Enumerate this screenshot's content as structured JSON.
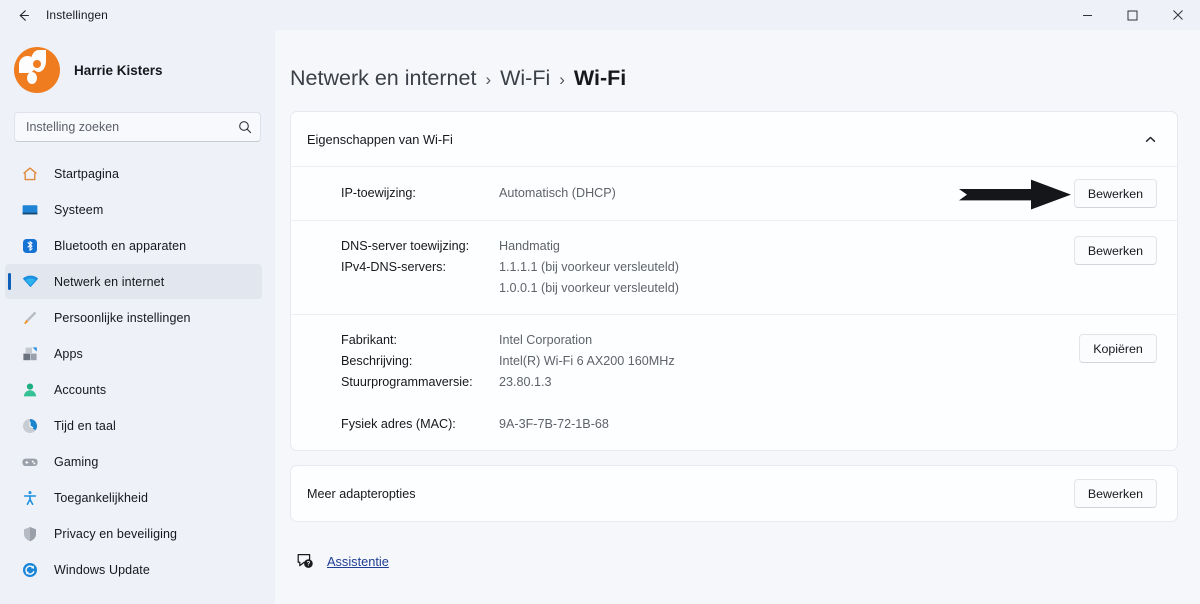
{
  "window": {
    "title": "Instellingen",
    "back_icon": "back-arrow-icon",
    "minimize_label": "−",
    "maximize_label": "□",
    "close_label": "✕"
  },
  "sidebar": {
    "profile": {
      "name": "Harrie Kisters",
      "avatar": "user-avatar"
    },
    "search": {
      "placeholder": "Instelling zoeken",
      "value": "",
      "icon": "search-icon"
    },
    "items": [
      {
        "label": "Startpagina",
        "icon": "home-icon",
        "selected": false
      },
      {
        "label": "Systeem",
        "icon": "monitor-icon",
        "selected": false
      },
      {
        "label": "Bluetooth en apparaten",
        "icon": "bluetooth-icon",
        "selected": false
      },
      {
        "label": "Netwerk en internet",
        "icon": "wifi-icon",
        "selected": true
      },
      {
        "label": "Persoonlijke instellingen",
        "icon": "paintbrush-icon",
        "selected": false
      },
      {
        "label": "Apps",
        "icon": "apps-icon",
        "selected": false
      },
      {
        "label": "Accounts",
        "icon": "account-icon",
        "selected": false
      },
      {
        "label": "Tijd en taal",
        "icon": "clock-icon",
        "selected": false
      },
      {
        "label": "Gaming",
        "icon": "gamepad-icon",
        "selected": false
      },
      {
        "label": "Toegankelijkheid",
        "icon": "accessibility-icon",
        "selected": false
      },
      {
        "label": "Privacy en beveiliging",
        "icon": "shield-icon",
        "selected": false
      },
      {
        "label": "Windows Update",
        "icon": "update-icon",
        "selected": false
      }
    ]
  },
  "breadcrumb": {
    "items": [
      "Netwerk en internet",
      "Wi-Fi",
      "Wi-Fi"
    ],
    "separator": "›"
  },
  "properties_card": {
    "header": "Eigenschappen van Wi-Fi",
    "collapse_icon": "chevron-up-icon",
    "rows": [
      {
        "labels": [
          "IP-toewijzing:"
        ],
        "values": [
          "Automatisch (DHCP)"
        ],
        "button": "Bewerken"
      },
      {
        "labels": [
          "DNS-server toewijzing:",
          "IPv4-DNS-servers:"
        ],
        "values": [
          "Handmatig",
          "1.1.1.1 (bij voorkeur versleuteld)",
          "1.0.0.1 (bij voorkeur versleuteld)"
        ],
        "button": "Bewerken"
      },
      {
        "labels": [
          "Fabrikant:",
          "Beschrijving:",
          "Stuurprogrammaversie:",
          "",
          "Fysiek adres (MAC):"
        ],
        "values": [
          "Intel Corporation",
          "Intel(R) Wi-Fi 6 AX200 160MHz",
          "23.80.1.3",
          "",
          "9A-3F-7B-72-1B-68"
        ],
        "button": "Kopiëren"
      }
    ]
  },
  "more_options": {
    "label": "Meer adapteropties",
    "button": "Bewerken"
  },
  "help": {
    "label": "Assistentie",
    "icon": "help-bubble-icon",
    "link_color": "#1f3f94"
  },
  "annotation": {
    "arrow": "right-arrow-annotation",
    "color": "#15161a"
  }
}
